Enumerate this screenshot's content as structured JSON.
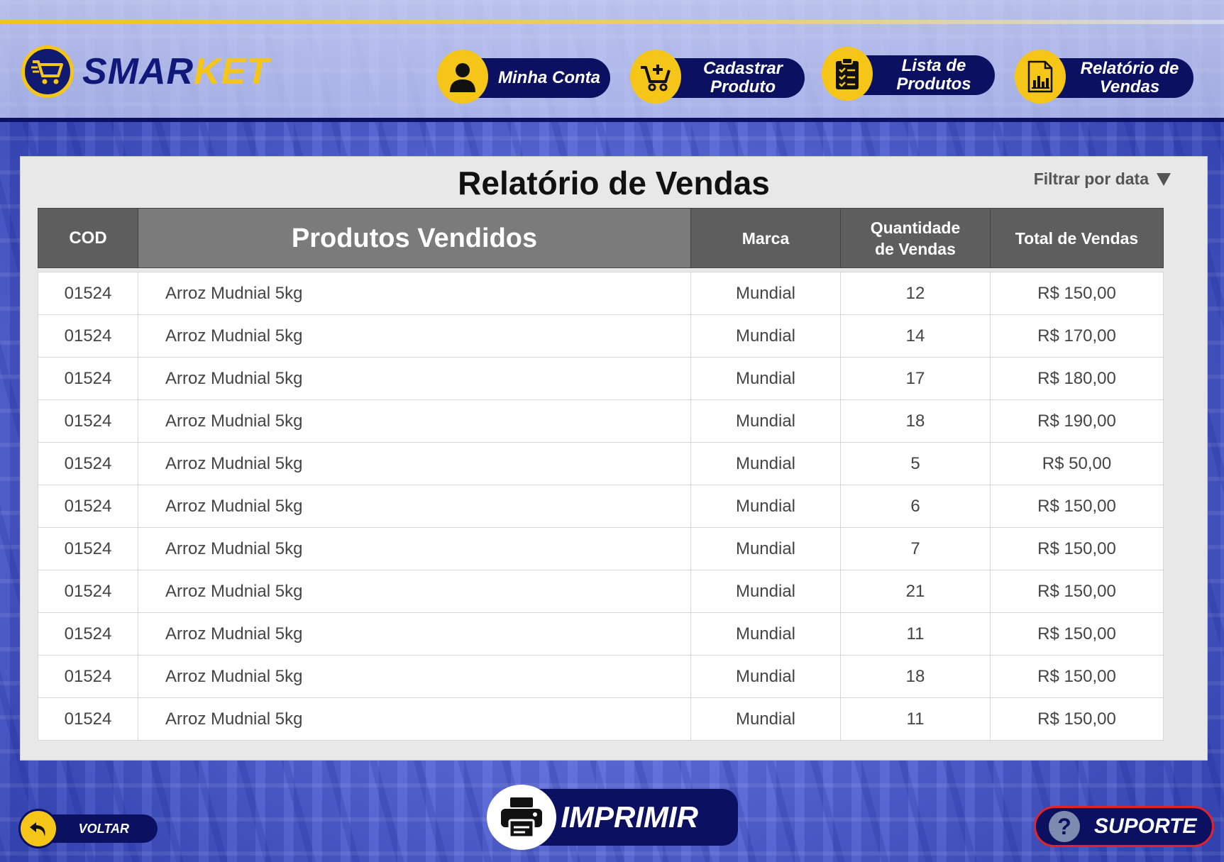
{
  "app": {
    "logo_main": "SMAR",
    "logo_accent": "KET",
    "colors": {
      "navy": "#0b1060",
      "yellow": "#f5c518",
      "danger": "#e0242a"
    }
  },
  "nav": {
    "minha_conta": {
      "label": "Minha Conta",
      "icon": "user-icon"
    },
    "cadastrar_produto": {
      "line1": "Cadastrar",
      "line2": "Produto",
      "icon": "cart-plus-icon"
    },
    "lista_produtos": {
      "line1": "Lista de",
      "line2": "Produtos",
      "icon": "clipboard-list-icon"
    },
    "relatorio_vendas": {
      "line1": "Relatório de",
      "line2": "Vendas",
      "icon": "report-chart-icon"
    }
  },
  "report": {
    "title": "Relatório de Vendas",
    "filter_label": "Filtrar por data",
    "columns": {
      "cod": "COD",
      "produtos": "Produtos Vendidos",
      "marca": "Marca",
      "quantidade_l1": "Quantidade",
      "quantidade_l2": "de Vendas",
      "total": "Total de Vendas"
    },
    "rows": [
      {
        "cod": "01524",
        "produto": "Arroz Mudnial 5kg",
        "marca": "Mundial",
        "quantidade": "12",
        "total": "R$ 150,00"
      },
      {
        "cod": "01524",
        "produto": "Arroz Mudnial 5kg",
        "marca": "Mundial",
        "quantidade": "14",
        "total": "R$ 170,00"
      },
      {
        "cod": "01524",
        "produto": "Arroz Mudnial 5kg",
        "marca": "Mundial",
        "quantidade": "17",
        "total": "R$ 180,00"
      },
      {
        "cod": "01524",
        "produto": "Arroz Mudnial 5kg",
        "marca": "Mundial",
        "quantidade": "18",
        "total": "R$ 190,00"
      },
      {
        "cod": "01524",
        "produto": "Arroz Mudnial 5kg",
        "marca": "Mundial",
        "quantidade": "5",
        "total": "R$ 50,00"
      },
      {
        "cod": "01524",
        "produto": "Arroz Mudnial 5kg",
        "marca": "Mundial",
        "quantidade": "6",
        "total": "R$ 150,00"
      },
      {
        "cod": "01524",
        "produto": "Arroz Mudnial 5kg",
        "marca": "Mundial",
        "quantidade": "7",
        "total": "R$ 150,00"
      },
      {
        "cod": "01524",
        "produto": "Arroz Mudnial 5kg",
        "marca": "Mundial",
        "quantidade": "21",
        "total": "R$ 150,00"
      },
      {
        "cod": "01524",
        "produto": "Arroz Mudnial 5kg",
        "marca": "Mundial",
        "quantidade": "11",
        "total": "R$ 150,00"
      },
      {
        "cod": "01524",
        "produto": "Arroz Mudnial 5kg",
        "marca": "Mundial",
        "quantidade": "18",
        "total": "R$ 150,00"
      },
      {
        "cod": "01524",
        "produto": "Arroz Mudnial 5kg",
        "marca": "Mundial",
        "quantidade": "11",
        "total": "R$ 150,00"
      }
    ]
  },
  "footer": {
    "voltar_label": "VOLTAR",
    "imprimir_label": "IMPRIMIR",
    "suporte_label": "SUPORTE",
    "suporte_icon_glyph": "?"
  }
}
